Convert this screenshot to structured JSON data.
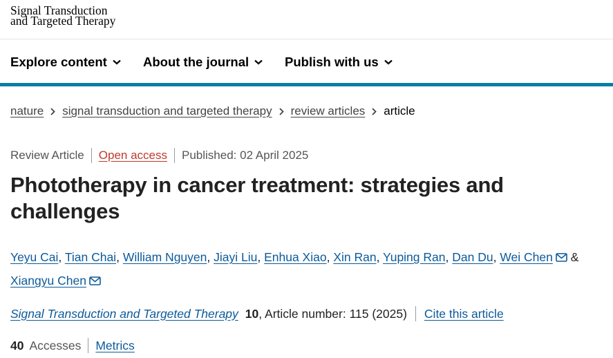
{
  "logo": {
    "line1": "Signal Transduction",
    "line2": "and Targeted Therapy"
  },
  "nav": [
    {
      "label": "Explore content"
    },
    {
      "label": "About the journal"
    },
    {
      "label": "Publish with us"
    }
  ],
  "breadcrumbs": [
    "nature",
    "signal transduction and targeted therapy",
    "review articles",
    "article"
  ],
  "meta": {
    "type": "Review Article",
    "access": "Open access",
    "published": "Published: 02 April 2025"
  },
  "title": "Phototherapy in cancer treatment: strategies and challenges",
  "authors": [
    "Yeyu Cai",
    "Tian Chai",
    "William Nguyen",
    "Jiayi Liu",
    "Enhua Xiao",
    "Xin Ran",
    "Yuping Ran",
    "Dan Du",
    "Wei Chen",
    "Xiangyu Chen"
  ],
  "citation": {
    "journal": "Signal Transduction and Targeted Therapy",
    "volume": "10",
    "article": ", Article number: 115 (2025)",
    "cite_link": "Cite this article"
  },
  "stats": {
    "accesses_count": "40",
    "accesses_label": "Accesses",
    "metrics_link": "Metrics"
  },
  "colors": {
    "accent_bar": "#0a7ea4",
    "link": "#0c5a9a",
    "open_access": "#c0392b"
  }
}
